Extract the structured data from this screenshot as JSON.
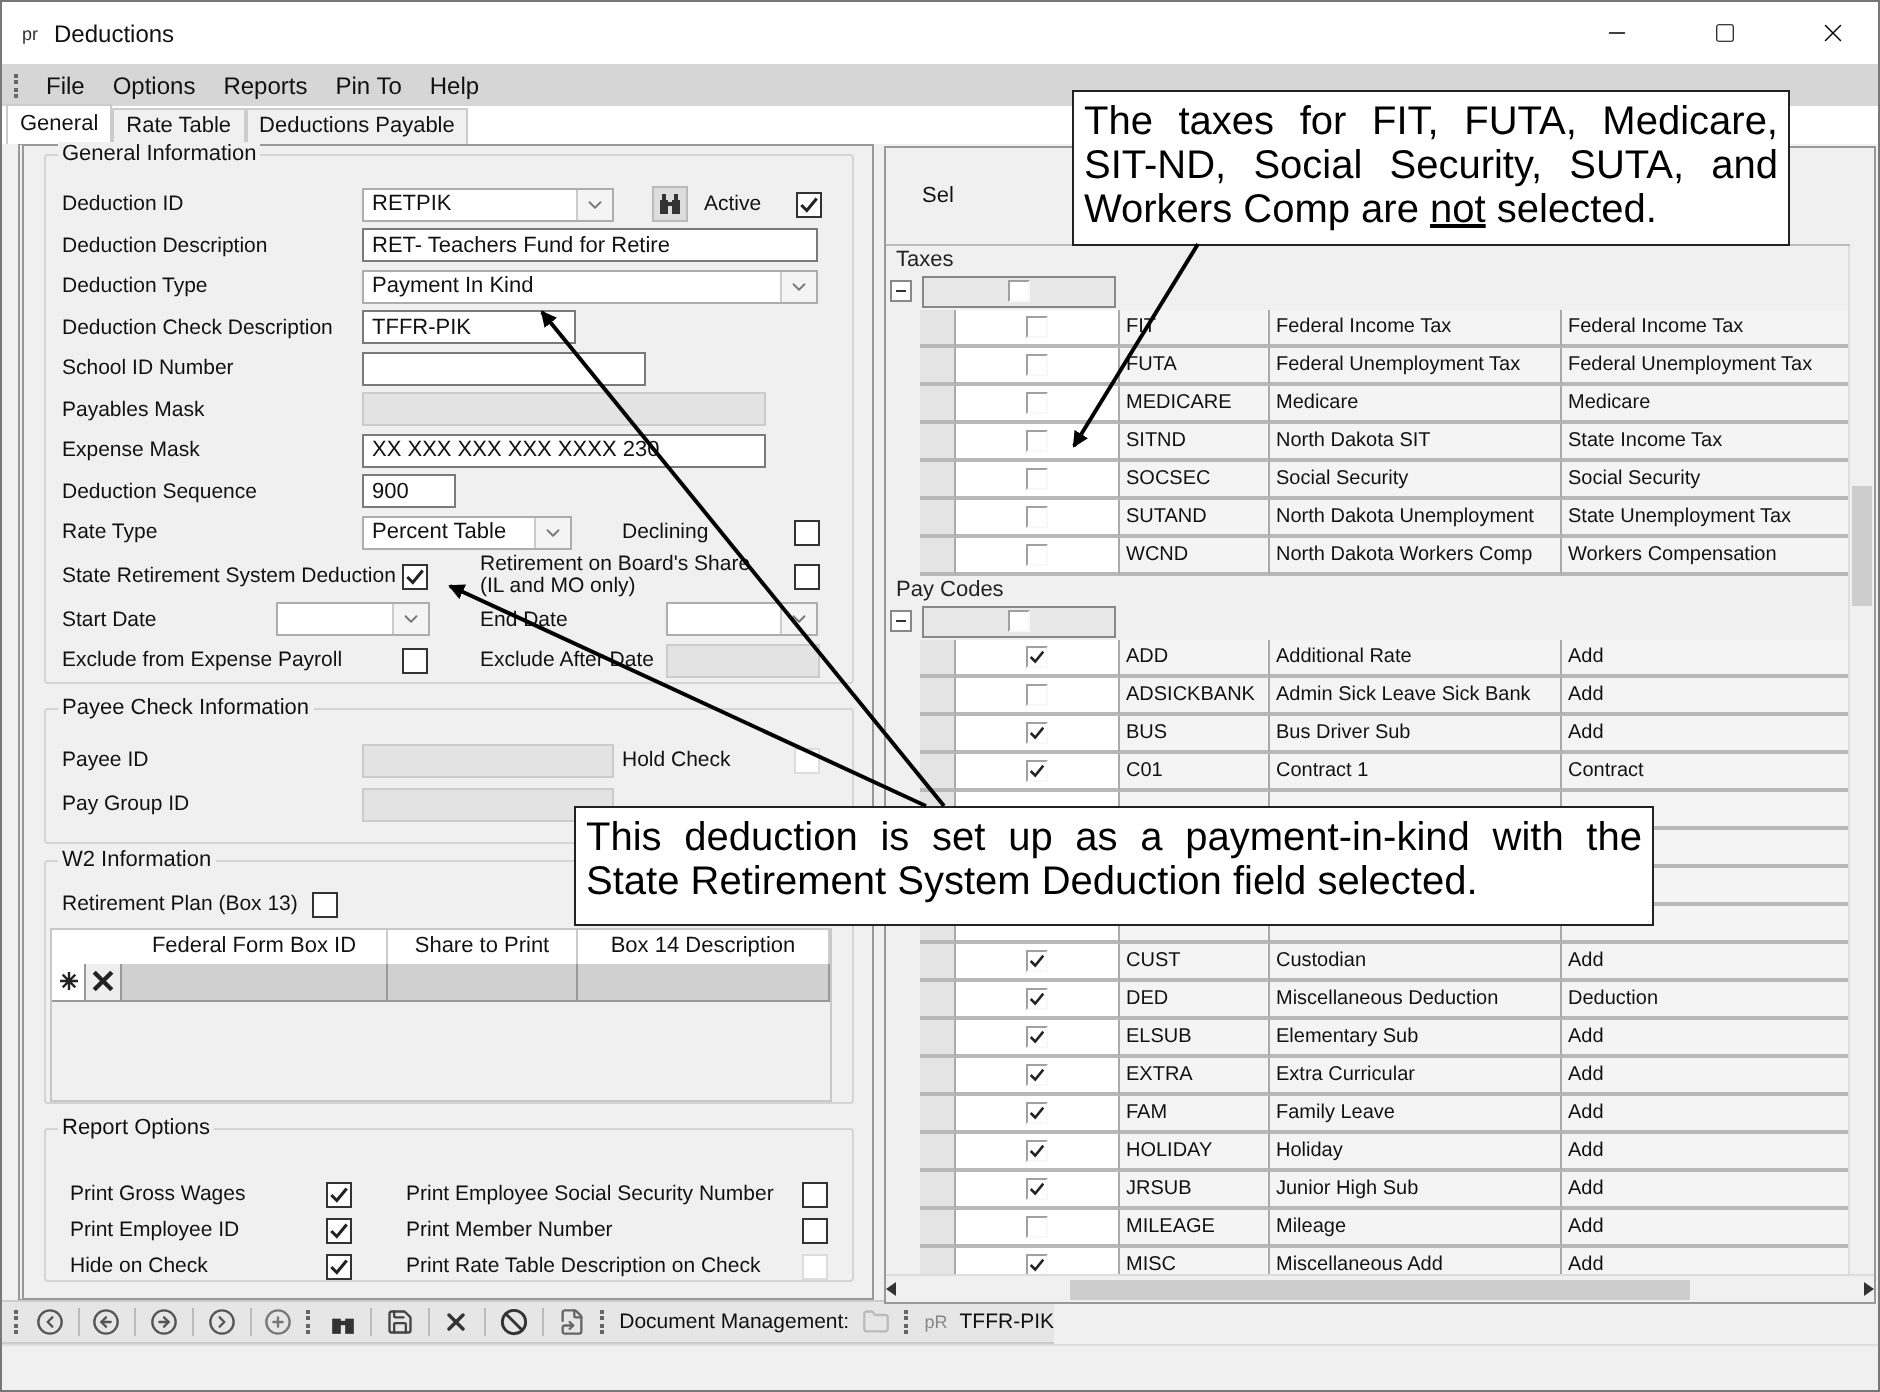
{
  "window": {
    "icon_text": "pr",
    "title": "Deductions"
  },
  "menu": [
    {
      "label": "File"
    },
    {
      "label": "Options"
    },
    {
      "label": "Reports"
    },
    {
      "label": "Pin To"
    },
    {
      "label": "Help"
    }
  ],
  "tabs": [
    {
      "label": "General",
      "selected": true
    },
    {
      "label": "Rate Table",
      "selected": false
    },
    {
      "label": "Deductions Payable",
      "selected": false
    }
  ],
  "general_information": {
    "title": "General Information",
    "deduction_id": {
      "label": "Deduction ID",
      "value": "RETPIK"
    },
    "active": {
      "label": "Active",
      "checked": true
    },
    "deduction_description": {
      "label": "Deduction Description",
      "value": "RET- Teachers Fund for Retire"
    },
    "deduction_type": {
      "label": "Deduction Type",
      "value": "Payment In Kind"
    },
    "deduction_check_description": {
      "label": "Deduction Check Description",
      "value": "TFFR-PIK"
    },
    "school_id_number": {
      "label": "School ID Number"
    },
    "payables_mask": {
      "label": "Payables Mask",
      "disabled": true
    },
    "expense_mask": {
      "label": "Expense Mask",
      "value": "XX XXX XXX XXX XXXX 230"
    },
    "deduction_sequence": {
      "label": "Deduction Sequence",
      "value": "900"
    },
    "rate_type": {
      "label": "Rate Type",
      "value": "Percent Table"
    },
    "declining": {
      "label": "Declining",
      "checked": false
    },
    "state_retirement": {
      "label": "State Retirement System Deduction",
      "checked": true
    },
    "retirement_on_boards_share": {
      "label": "Retirement on Board's Share",
      "note": "(IL and MO only)",
      "checked": false
    },
    "start_date": {
      "label": "Start Date"
    },
    "end_date": {
      "label": "End Date"
    },
    "exclude_from_expense_payroll": {
      "label": "Exclude from Expense Payroll",
      "checked": false
    },
    "exclude_after_date": {
      "label": "Exclude After Date",
      "disabled": true
    }
  },
  "payee_check_information": {
    "title": "Payee Check Information",
    "payee_id": {
      "label": "Payee ID",
      "disabled": true
    },
    "hold_check": {
      "label": "Hold Check",
      "checked": false,
      "disabled": true
    },
    "pay_group_id": {
      "label": "Pay Group ID",
      "disabled": true
    }
  },
  "w2_information": {
    "title": "W2 Information",
    "retirement_plan": {
      "label": "Retirement Plan (Box 13)",
      "checked": false
    },
    "columns": [
      "Federal Form Box ID",
      "Share to Print",
      "Box 14 Description"
    ]
  },
  "report_options": {
    "title": "Report Options",
    "options": [
      {
        "label": "Print Gross Wages",
        "checked": true,
        "disabled": false
      },
      {
        "label": "Print Employee Social Security Number",
        "checked": false,
        "disabled": false
      },
      {
        "label": "Print Employee ID",
        "checked": true,
        "disabled": false
      },
      {
        "label": "Print Member Number",
        "checked": false,
        "disabled": false
      },
      {
        "label": "Hide on Check",
        "checked": true,
        "disabled": false
      },
      {
        "label": "Print Rate Table Description on Check",
        "checked": false,
        "disabled": true
      }
    ]
  },
  "selection_grid": {
    "header": "Sel",
    "groups": [
      {
        "title": "Taxes",
        "expanded": true,
        "checked": false,
        "rows": [
          {
            "kind": "data",
            "code": "FIT",
            "description": "Federal Income Tax",
            "type": "Federal Income Tax",
            "checked": false
          },
          {
            "kind": "data",
            "code": "FUTA",
            "description": "Federal Unemployment Tax",
            "type": "Federal Unemployment Tax",
            "checked": false
          },
          {
            "kind": "data",
            "code": "MEDICARE",
            "description": "Medicare",
            "type": "Medicare",
            "checked": false
          },
          {
            "kind": "data",
            "code": "SITND",
            "description": "North Dakota SIT",
            "type": "State Income Tax",
            "checked": false
          },
          {
            "kind": "data",
            "code": "SOCSEC",
            "description": "Social Security",
            "type": "Social Security",
            "checked": false
          },
          {
            "kind": "data",
            "code": "SUTAND",
            "description": "North Dakota Unemployment",
            "type": "State Unemployment Tax",
            "checked": false
          },
          {
            "kind": "data",
            "code": "WCND",
            "description": "North Dakota Workers Comp",
            "type": "Workers Compensation",
            "checked": false
          }
        ]
      },
      {
        "title": "Pay Codes",
        "expanded": true,
        "checked": false,
        "rows": [
          {
            "kind": "data",
            "code": "ADD",
            "description": "Additional Rate",
            "type": "Add",
            "checked": true
          },
          {
            "kind": "data",
            "code": "ADSICKBANK",
            "description": "Admin Sick Leave Sick Bank",
            "type": "Add",
            "checked": false
          },
          {
            "kind": "data",
            "code": "BUS",
            "description": "Bus Driver Sub",
            "type": "Add",
            "checked": true
          },
          {
            "kind": "data",
            "code": "C01",
            "description": "Contract 1",
            "type": "Contract",
            "checked": true
          },
          {
            "kind": "covered"
          },
          {
            "kind": "covered"
          },
          {
            "kind": "covered"
          },
          {
            "kind": "covered"
          },
          {
            "kind": "data",
            "code": "CUST",
            "description": "Custodian",
            "type": "Add",
            "checked": true
          },
          {
            "kind": "data",
            "code": "DED",
            "description": "Miscellaneous Deduction",
            "type": "Deduction",
            "checked": true
          },
          {
            "kind": "data",
            "code": "ELSUB",
            "description": "Elementary Sub",
            "type": "Add",
            "checked": true
          },
          {
            "kind": "data",
            "code": "EXTRA",
            "description": "Extra Curricular",
            "type": "Add",
            "checked": true
          },
          {
            "kind": "data",
            "code": "FAM",
            "description": "Family Leave",
            "type": "Add",
            "checked": true
          },
          {
            "kind": "data",
            "code": "HOLIDAY",
            "description": "Holiday",
            "type": "Add",
            "checked": true
          },
          {
            "kind": "data",
            "code": "JRSUB",
            "description": "Junior High Sub",
            "type": "Add",
            "checked": true
          },
          {
            "kind": "data",
            "code": "MILEAGE",
            "description": "Mileage",
            "type": "Add",
            "checked": false
          },
          {
            "kind": "data",
            "code": "MISC",
            "description": "Miscellaneous Add",
            "type": "Add",
            "checked": true
          }
        ]
      }
    ]
  },
  "toolbar": {
    "document_management": "Document Management:",
    "report_badge": "pR",
    "record": "TFFR-PIK"
  },
  "callouts": [
    {
      "text": "The taxes for FIT, FUTA, Medicare, SIT-ND, Social Security, SUTA, and Workers Comp are ",
      "underlined": "not",
      "text_after": " selected."
    },
    {
      "text": "This deduction is set up as a payment-in-kind with the State Retirement System Deduction field selected."
    }
  ]
}
